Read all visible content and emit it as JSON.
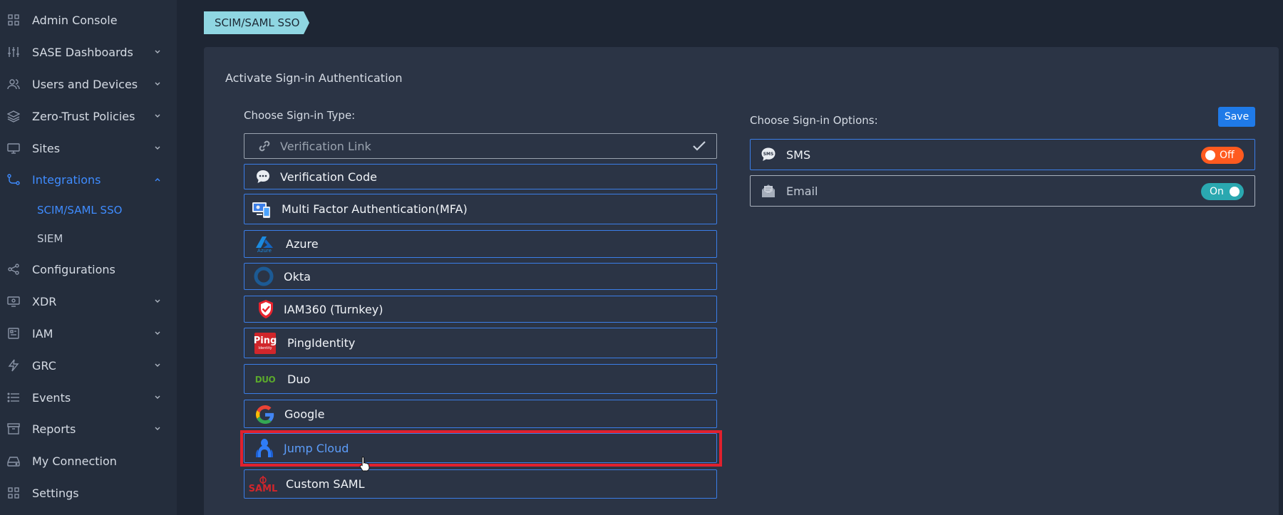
{
  "sidebar": {
    "items": [
      {
        "label": "Admin Console",
        "icon": "grid-icon"
      },
      {
        "label": "SASE Dashboards",
        "icon": "sliders-icon"
      },
      {
        "label": "Users and Devices",
        "icon": "users-icon"
      },
      {
        "label": "Zero-Trust Policies",
        "icon": "layers-icon"
      },
      {
        "label": "Sites",
        "icon": "monitor-icon"
      },
      {
        "label": "Integrations",
        "icon": "integrations-icon"
      },
      {
        "label": "Configurations",
        "icon": "share-icon"
      },
      {
        "label": "XDR",
        "icon": "xdr-icon"
      },
      {
        "label": "IAM",
        "icon": "iam-icon"
      },
      {
        "label": "GRC",
        "icon": "bolt-icon"
      },
      {
        "label": "Events",
        "icon": "list-icon"
      },
      {
        "label": "Reports",
        "icon": "archive-icon"
      },
      {
        "label": "My Connection",
        "icon": "drive-icon"
      },
      {
        "label": "Settings",
        "icon": "grid-icon"
      }
    ],
    "subitems": [
      {
        "label": "SCIM/SAML SSO"
      },
      {
        "label": "SIEM"
      }
    ]
  },
  "breadcrumb": {
    "label": "SCIM/SAML SSO"
  },
  "panel": {
    "title": "Activate Sign-in Authentication",
    "signin_type_title": "Choose Sign-in Type:",
    "signin_options_title": "Choose Sign-in Options:",
    "save_label": "Save"
  },
  "signin_types": [
    {
      "label": "Verification Link",
      "icon": "link-icon"
    },
    {
      "label": "Verification Code",
      "icon": "chat-bubble-icon"
    },
    {
      "label": "Multi Factor Authentication(MFA)",
      "icon": "mfa-icon"
    },
    {
      "label": "Azure",
      "icon": "azure-logo-icon",
      "logo_text": "Azure"
    },
    {
      "label": "Okta",
      "icon": "okta-logo-icon"
    },
    {
      "label": "IAM360 (Turnkey)",
      "icon": "shield-check-icon"
    },
    {
      "label": "PingIdentity",
      "icon": "ping-logo-icon",
      "logo_text": "Ping",
      "logo_subtext": "Identity"
    },
    {
      "label": "Duo",
      "icon": "duo-logo-icon",
      "logo_text": "DUO"
    },
    {
      "label": "Google",
      "icon": "google-logo-icon"
    },
    {
      "label": "Jump Cloud",
      "icon": "jumpcloud-logo-icon"
    },
    {
      "label": "Custom SAML",
      "icon": "saml-logo-icon",
      "logo_text": "SAML"
    }
  ],
  "signin_options": [
    {
      "label": "SMS",
      "icon": "sms-icon",
      "icon_text": "SMS",
      "state": "Off"
    },
    {
      "label": "Email",
      "icon": "envelope-icon",
      "state": "On"
    }
  ],
  "colors": {
    "accent": "#3f8cff",
    "toggle_off": "#ff5a1f",
    "toggle_on": "#2aa8b0",
    "highlight": "#e0212e"
  }
}
